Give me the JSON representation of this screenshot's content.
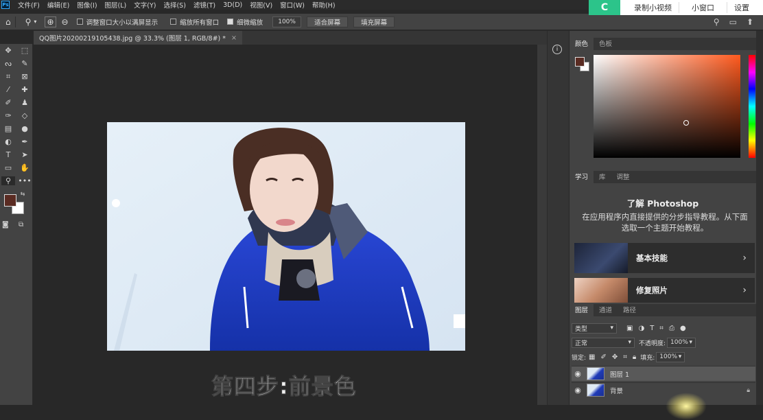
{
  "menubar": {
    "logo": "Ps",
    "items": [
      "文件(F)",
      "编辑(E)",
      "图像(I)",
      "图层(L)",
      "文字(Y)",
      "选择(S)",
      "滤镜(T)",
      "3D(D)",
      "视图(V)",
      "窗口(W)",
      "帮助(H)"
    ]
  },
  "recorder": {
    "logo": "C",
    "buttons": [
      "录制小视频",
      "小窗口",
      "设置"
    ]
  },
  "options": {
    "check_resize": "调整窗口大小以满屏显示",
    "check_zoom_all": "缩放所有窗口",
    "check_scrubby": "细微缩放",
    "zoom_value": "100%",
    "fit_screen": "适合屏幕",
    "fill_screen": "填充屏幕"
  },
  "document": {
    "tab_title": "QQ图片20200219105438.jpg @ 33.3% (图层 1, RGB/8#) *",
    "close": "×"
  },
  "caption": "第四步:前景色",
  "color_panel": {
    "tabs": [
      "颜色",
      "色板"
    ],
    "foreground": "#5a2b22",
    "background": "#ffffff"
  },
  "learn_panel": {
    "tabs": [
      "学习",
      "库",
      "调整"
    ],
    "title": "了解 Photoshop",
    "description": "在应用程序内直接提供的分步指导教程。从下面选取一个主题开始教程。",
    "cards": [
      "基本技能",
      "修复照片"
    ]
  },
  "layers_panel": {
    "tabs": [
      "图层",
      "通道",
      "路径"
    ],
    "filter_kind": "类型",
    "blend_mode": "正常",
    "opacity_label": "不透明度:",
    "opacity_value": "100%",
    "lock_label": "锁定:",
    "fill_label": "填充:",
    "fill_value": "100%",
    "layers": [
      "图层 1",
      "背景"
    ]
  }
}
